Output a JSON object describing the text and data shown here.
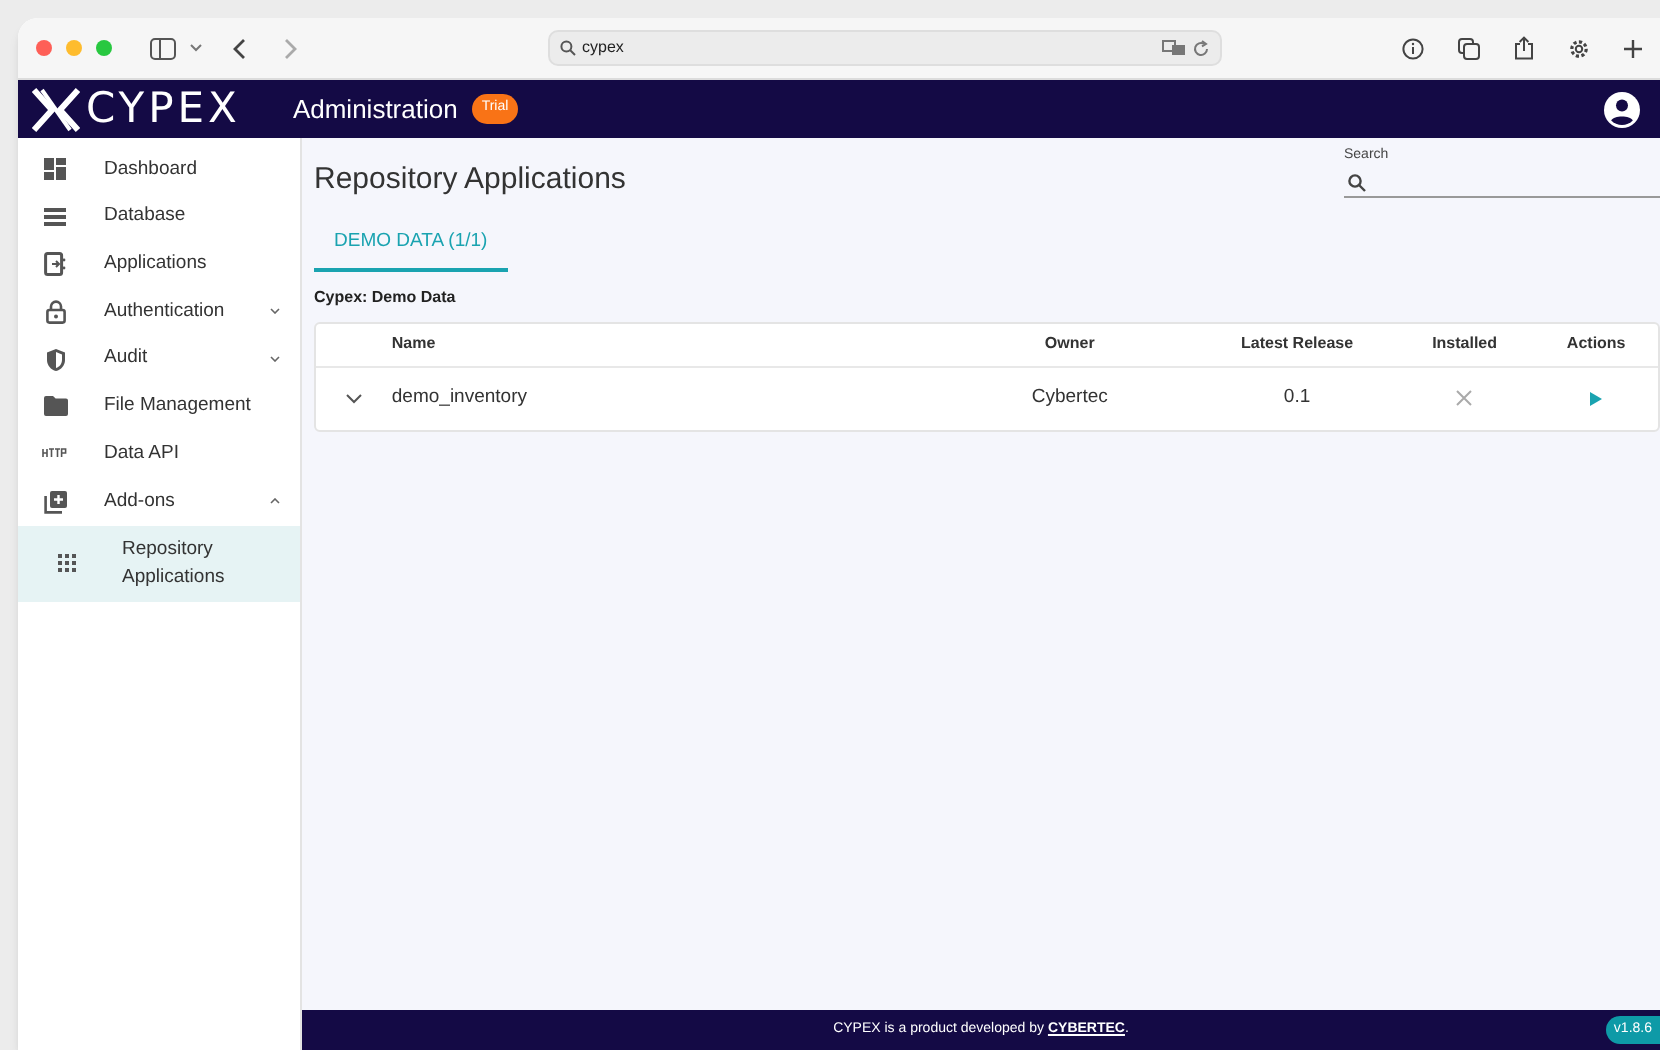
{
  "browser": {
    "address": "cypex"
  },
  "header": {
    "logo": "CYPEX",
    "title": "Administration",
    "badge": "Trial"
  },
  "sidebar": {
    "items": [
      {
        "label": "Dashboard",
        "selected": false
      },
      {
        "label": "Database",
        "selected": false
      },
      {
        "label": "Applications",
        "selected": false
      },
      {
        "label": "Authentication",
        "selected": false,
        "expanded": false
      },
      {
        "label": "Audit",
        "selected": false,
        "expanded": false
      },
      {
        "label": "File Management",
        "selected": false
      },
      {
        "label": "Data API",
        "selected": false
      },
      {
        "label": "Add-ons",
        "selected": false,
        "expanded": true,
        "children": [
          {
            "label": "Repository Applications",
            "selected": true
          }
        ]
      }
    ]
  },
  "page": {
    "title": "Repository Applications",
    "search": {
      "label": "Search"
    },
    "tabs": [
      {
        "label": "DEMO DATA (1/1)",
        "selected": true
      }
    ],
    "section_title": "Cypex: Demo Data",
    "table": {
      "columns": [
        "Name",
        "Owner",
        "Latest Release",
        "Installed",
        "Actions"
      ],
      "rows": [
        {
          "expanded": false,
          "name": "demo_inventory",
          "owner": "Cybertec",
          "latest_release": "0.1",
          "installed": false
        }
      ]
    }
  },
  "footer": {
    "text": "CYPEX is a product developed by ",
    "link": "CYBERTEC",
    "text_after": ".",
    "version": "v1.8.6"
  }
}
